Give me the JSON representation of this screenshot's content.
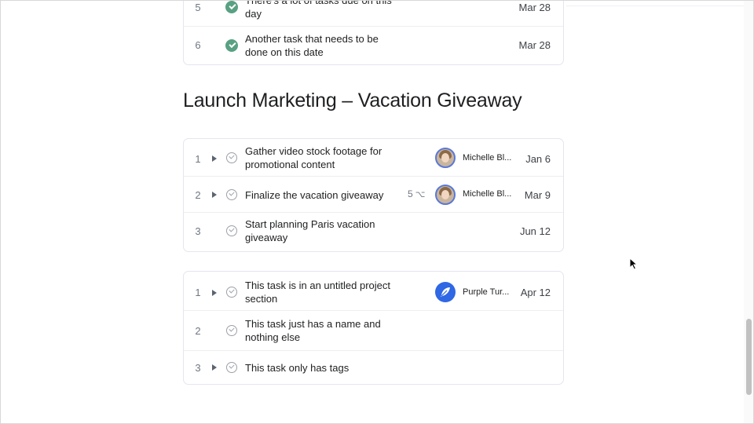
{
  "top_card": {
    "rows": [
      {
        "num": "5",
        "title": "There's a lot of tasks due on this day",
        "date": "Mar 28"
      },
      {
        "num": "6",
        "title": "Another task that needs to be done on this date",
        "date": "Mar 28"
      }
    ]
  },
  "section": {
    "title": "Launch Marketing – Vacation Giveaway",
    "rows": [
      {
        "num": "1",
        "title": "Gather video stock footage for promotional content",
        "assignee": "Michelle Bl...",
        "date": "Jan 6"
      },
      {
        "num": "2",
        "title": "Finalize the vacation giveaway",
        "subtasks": "5",
        "subtask_icon": "⌥",
        "assignee": "Michelle Bl...",
        "date": "Mar 9"
      },
      {
        "num": "3",
        "title": "Start planning Paris vacation giveaway",
        "date": "Jun 12"
      }
    ]
  },
  "untitled": {
    "rows": [
      {
        "num": "1",
        "title": "This task is in an untitled project section",
        "assignee": "Purple Tur...",
        "date": "Apr 12"
      },
      {
        "num": "2",
        "title": "This task just has a name and nothing else"
      },
      {
        "num": "3",
        "title": "This task only has tags"
      }
    ]
  },
  "icons": {
    "caret": "caret-right-icon",
    "check": "check-circle-icon",
    "subtask": "subtask-icon",
    "team_avatar": "feather-icon"
  },
  "colors": {
    "complete_green": "#58a182",
    "team_blue": "#2f67e4"
  }
}
